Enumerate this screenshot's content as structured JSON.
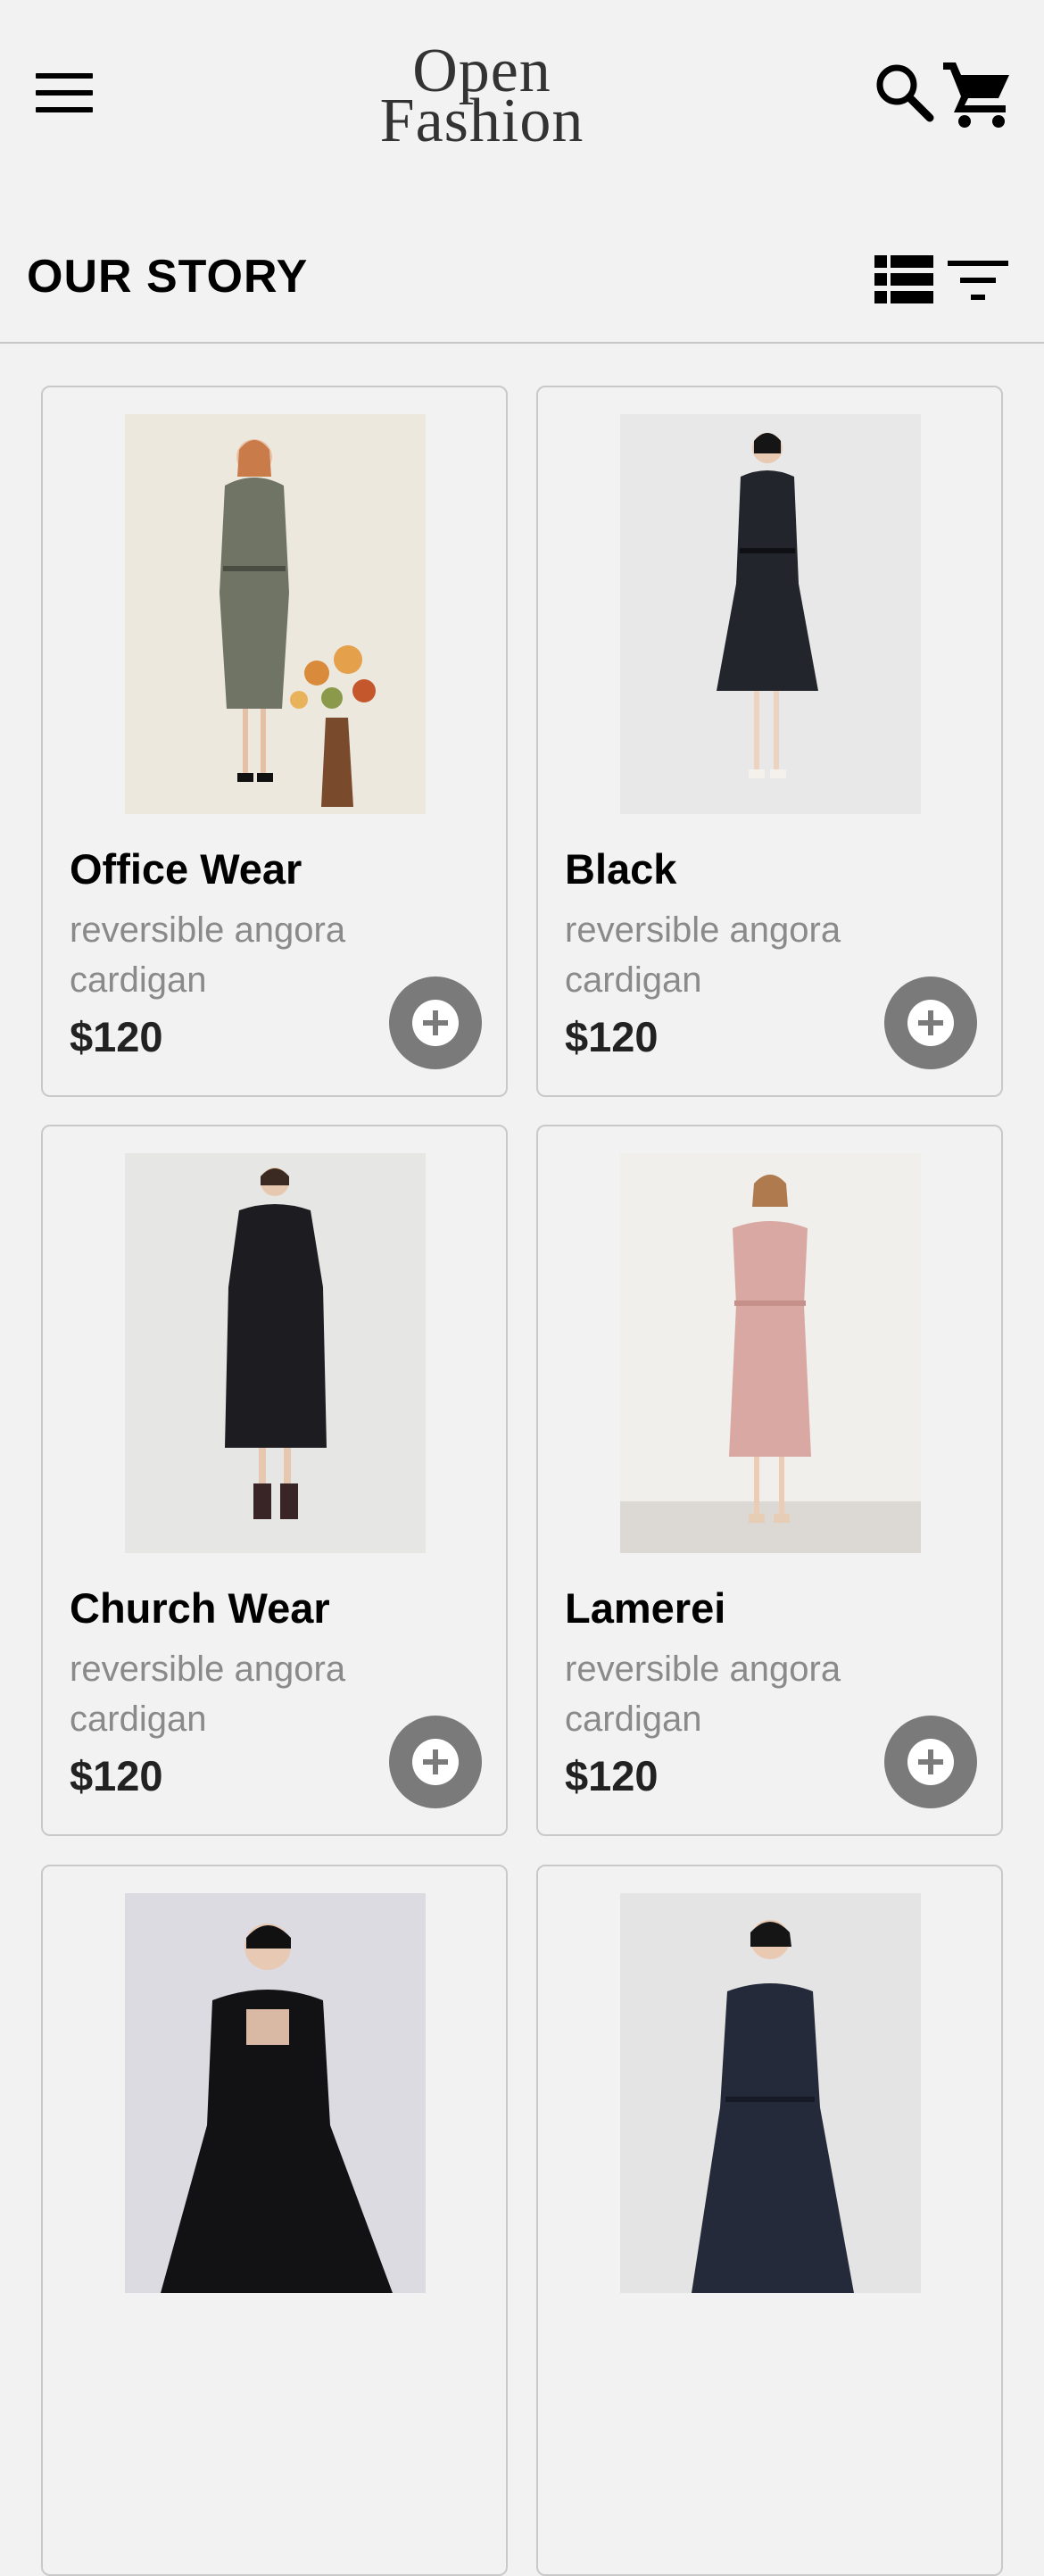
{
  "header": {
    "logo_line1": "Open",
    "logo_line2": "Fashion",
    "menu_icon": "hamburger-menu-icon",
    "search_icon": "search-icon",
    "cart_icon": "shopping-cart-icon"
  },
  "section": {
    "title": "OUR STORY",
    "view_icon": "list-view-icon",
    "filter_icon": "filter-icon"
  },
  "colors": {
    "background": "#f2f2f2",
    "card_border": "#c9c9c9",
    "add_button": "#7a7a7a",
    "description": "#8a8a8a"
  },
  "products": [
    {
      "name": "Office Wear",
      "description": "reversible angora cardigan",
      "price": "$120",
      "add_icon": "plus-circle-icon"
    },
    {
      "name": "Black",
      "description": "reversible angora cardigan",
      "price": "$120",
      "add_icon": "plus-circle-icon"
    },
    {
      "name": "Church Wear",
      "description": "reversible angora cardigan",
      "price": "$120",
      "add_icon": "plus-circle-icon"
    },
    {
      "name": "Lamerei",
      "description": "reversible angora cardigan",
      "price": "$120",
      "add_icon": "plus-circle-icon"
    },
    {
      "name": "",
      "description": "",
      "price": "",
      "add_icon": "plus-circle-icon"
    },
    {
      "name": "",
      "description": "",
      "price": "",
      "add_icon": "plus-circle-icon"
    }
  ]
}
